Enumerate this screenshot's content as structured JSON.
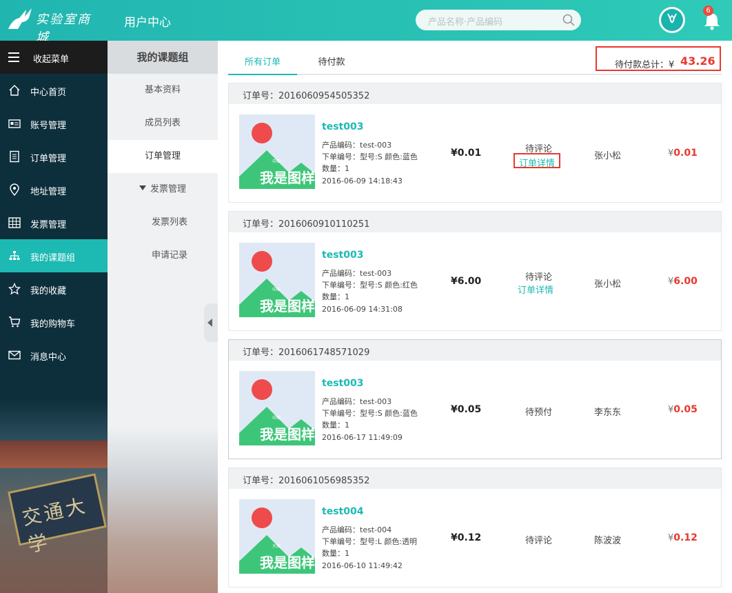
{
  "header": {
    "logo_text": "实验室商城",
    "title": "用户中心",
    "search_placeholder": "产品名称·产品编码",
    "notification_count": "6"
  },
  "sidebar": {
    "toggle_label": "收起菜单",
    "items": [
      {
        "label": "中心首页",
        "icon": "home-icon"
      },
      {
        "label": "账号管理",
        "icon": "id-card-icon"
      },
      {
        "label": "订单管理",
        "icon": "document-icon"
      },
      {
        "label": "地址管理",
        "icon": "location-pin-icon"
      },
      {
        "label": "发票管理",
        "icon": "grid-table-icon"
      },
      {
        "label": "我的课题组",
        "icon": "org-chart-icon",
        "active": true
      },
      {
        "label": "我的收藏",
        "icon": "star-icon"
      },
      {
        "label": "我的购物车",
        "icon": "cart-icon"
      },
      {
        "label": "消息中心",
        "icon": "envelope-icon"
      }
    ],
    "bg_sign_text": "交通大学"
  },
  "subsidebar": {
    "title": "我的课题组",
    "items": [
      {
        "label": "基本资料"
      },
      {
        "label": "成员列表"
      },
      {
        "label": "订单管理",
        "active": true
      },
      {
        "label": "发票管理",
        "expanded": true
      },
      {
        "label": "发票列表"
      },
      {
        "label": "申请记录"
      }
    ]
  },
  "main": {
    "tabs": [
      {
        "label": "所有订单",
        "active": true
      },
      {
        "label": "待付款"
      }
    ],
    "total_label": "待付款总计：¥",
    "total_value": "43.26",
    "order_no_label": "订单号：",
    "orders": [
      {
        "order_no": "2016060954505352",
        "product_name": "test003",
        "product_code": "产品编码：test-003",
        "spec": "下单编号：型号:S 颜色:蓝色",
        "quantity": "数量：1",
        "time": "2016-06-09 14:18:43",
        "price": "¥0.01",
        "status": "待评论",
        "detail_link": "订单详情",
        "buyer": "张小松",
        "currency": "¥",
        "amount": "0.01",
        "thumb_caption": "我是图样",
        "thumb_tag": "中图"
      },
      {
        "order_no": "2016060910110251",
        "product_name": "test003",
        "product_code": "产品编码：test-003",
        "spec": "下单编号：型号:S 颜色:红色",
        "quantity": "数量：1",
        "time": "2016-06-09 14:31:08",
        "price": "¥6.00",
        "status": "待评论",
        "detail_link": "订单详情",
        "buyer": "张小松",
        "currency": "¥",
        "amount": "6.00",
        "thumb_caption": "我是图样",
        "thumb_tag": "中图"
      },
      {
        "order_no": "2016061748571029",
        "product_name": "test003",
        "product_code": "产品编码：test-003",
        "spec": "下单编号：型号:S 颜色:蓝色",
        "quantity": "数量：1",
        "time": "2016-06-17 11:49:09",
        "price": "¥0.05",
        "status": "待预付",
        "buyer": "李东东",
        "currency": "¥",
        "amount": "0.05",
        "thumb_caption": "我是图样",
        "thumb_tag": "中图"
      },
      {
        "order_no": "2016061056985352",
        "product_name": "test004",
        "product_code": "产品编码：test-004",
        "spec": "下单编号：型号:L 颜色:透明",
        "quantity": "数量：1",
        "time": "2016-06-10 11:49:42",
        "price": "¥0.12",
        "status": "待评论",
        "buyer": "陈波波",
        "currency": "¥",
        "amount": "0.12",
        "thumb_caption": "我是图样",
        "thumb_tag": "大图"
      }
    ]
  },
  "colors": {
    "accent": "#1db9b3",
    "sidebar_bg": "#0d2f3c",
    "price_red": "#e8382e"
  }
}
